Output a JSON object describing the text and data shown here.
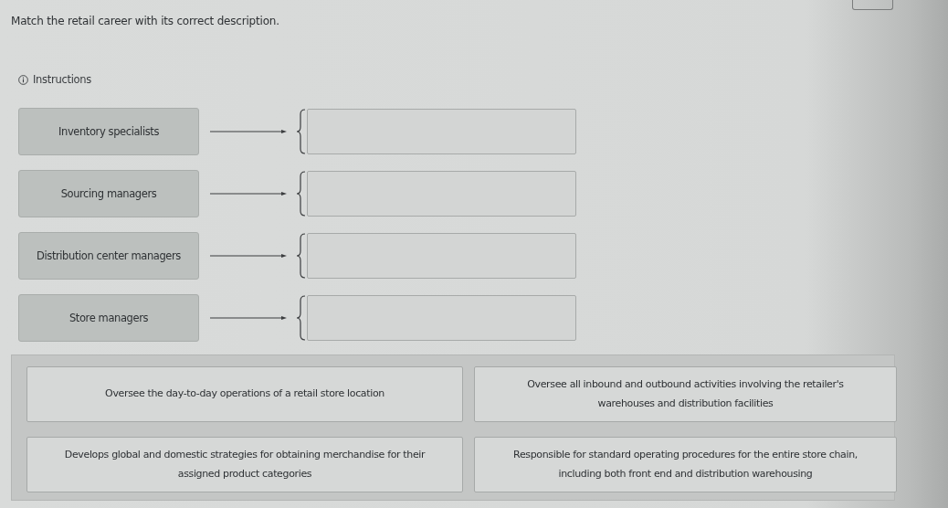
{
  "prompt": "Match the retail career with its correct description.",
  "instructions": {
    "label": "Instructions"
  },
  "careers": [
    {
      "label": "Inventory specialists"
    },
    {
      "label": "Sourcing managers"
    },
    {
      "label": "Distribution center managers"
    },
    {
      "label": "Store managers"
    }
  ],
  "descriptions": [
    {
      "text": "Oversee the day-to-day operations of a retail store location"
    },
    {
      "text": "Develops global and domestic strategies  for obtaining merchandise for their assigned product categories"
    },
    {
      "text": "Oversee all inbound and outbound activities involving the retailer's warehouses and distribution facilities"
    },
    {
      "text": "Responsible for standard operating procedures for the entire store chain, including both front end and distribution warehousing"
    }
  ]
}
